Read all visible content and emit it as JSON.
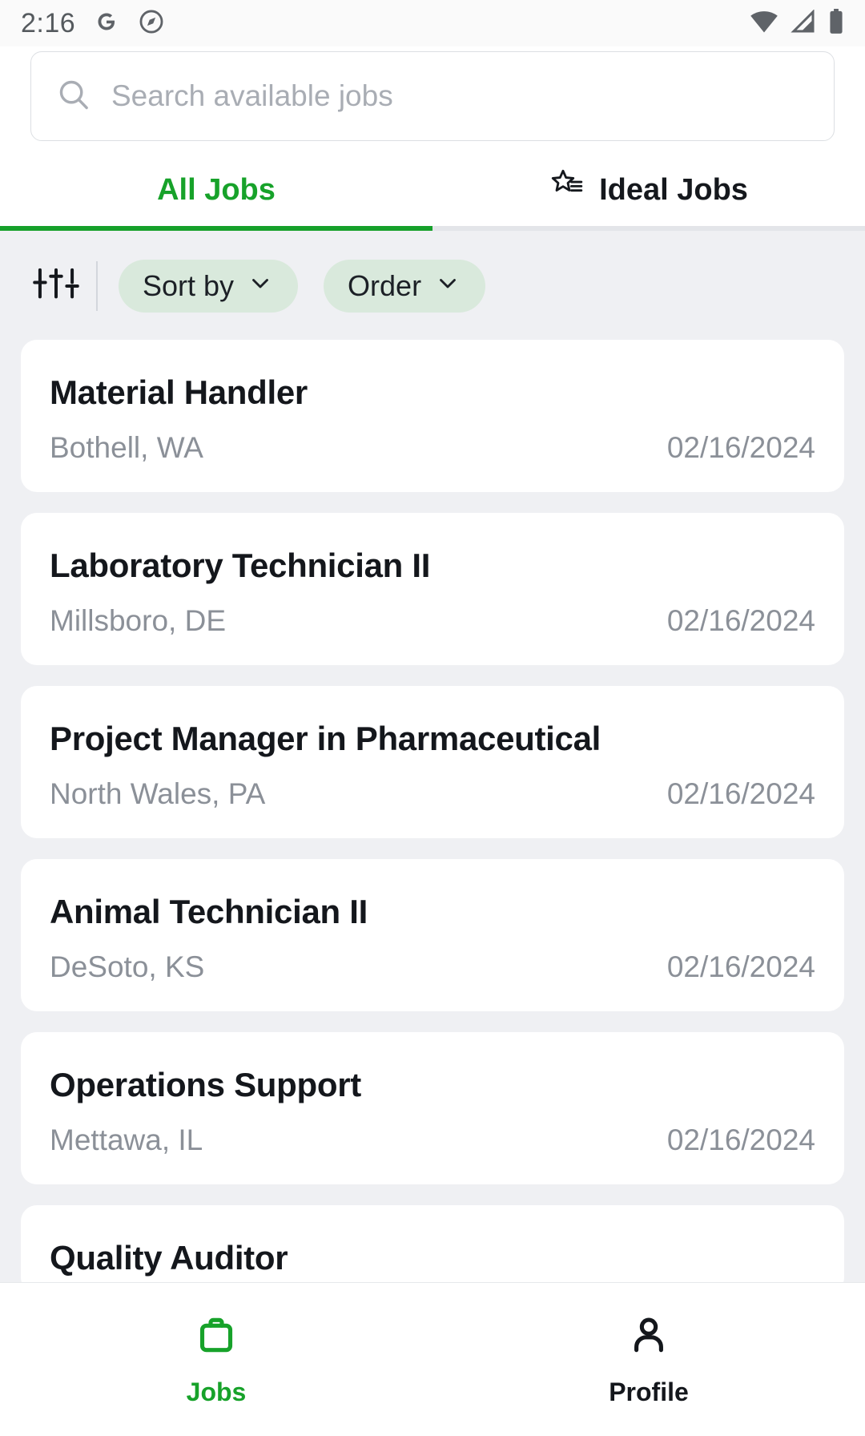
{
  "status_bar": {
    "time": "2:16",
    "left_icons": [
      "google-g-icon",
      "compass-circle-icon"
    ],
    "right_icons": [
      "wifi-icon",
      "cellular-signal-icon",
      "battery-icon"
    ]
  },
  "search": {
    "placeholder": "Search available jobs",
    "value": "",
    "icon": "search-icon"
  },
  "tabs": [
    {
      "label": "All Jobs",
      "active": true,
      "icon": null
    },
    {
      "label": "Ideal Jobs",
      "active": false,
      "icon": "star-list-icon"
    }
  ],
  "filters": {
    "tune_icon": "tune-sliders-icon",
    "chips": [
      {
        "label": "Sort by",
        "icon": "chevron-down-icon"
      },
      {
        "label": "Order",
        "icon": "chevron-down-icon"
      }
    ]
  },
  "jobs": [
    {
      "title": "Material Handler",
      "location": "Bothell, WA",
      "date": "02/16/2024"
    },
    {
      "title": "Laboratory Technician II",
      "location": "Millsboro, DE",
      "date": "02/16/2024"
    },
    {
      "title": "Project Manager in Pharmaceutical",
      "location": "North Wales, PA",
      "date": "02/16/2024"
    },
    {
      "title": "Animal Technician II",
      "location": "DeSoto, KS",
      "date": "02/16/2024"
    },
    {
      "title": "Operations Support",
      "location": "Mettawa, IL",
      "date": "02/16/2024"
    },
    {
      "title": "Quality Auditor",
      "location": "",
      "date": ""
    }
  ],
  "bottom_nav": [
    {
      "label": "Jobs",
      "icon": "briefcase-icon",
      "active": true
    },
    {
      "label": "Profile",
      "icon": "person-icon",
      "active": false
    }
  ],
  "colors": {
    "accent_green": "#17a22a",
    "chip_bg": "#d9e9dc",
    "page_bg": "#eff0f3",
    "muted_text": "#8b9098"
  }
}
